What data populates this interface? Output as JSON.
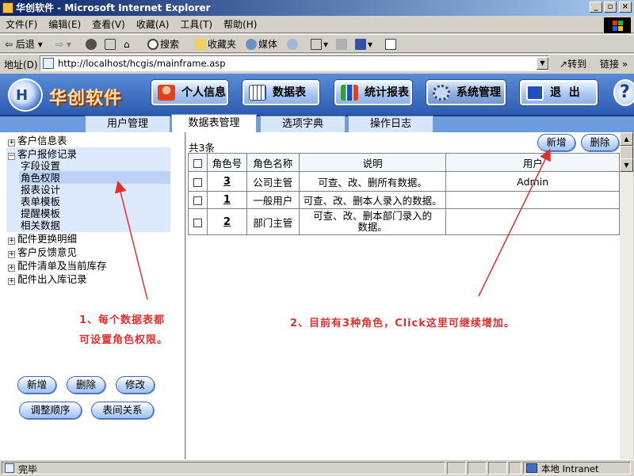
{
  "window": {
    "title": "华创软件 - Microsoft Internet Explorer"
  },
  "menu": [
    "文件(F)",
    "编辑(E)",
    "查看(V)",
    "收藏(A)",
    "工具(T)",
    "帮助(H)"
  ],
  "toolbar": {
    "back": "后退",
    "search": "搜索",
    "favorites": "收藏夹",
    "media": "媒体"
  },
  "address": {
    "label": "地址(D)",
    "url": "http://localhost/hcgis/mainframe.asp",
    "go": "转到",
    "links": "链接"
  },
  "app": {
    "logo_text": "华创软件",
    "logo_mark": "H",
    "nav": [
      "个人信息",
      "数据表",
      "统计报表",
      "系统管理",
      "退  出"
    ],
    "help": "?"
  },
  "tabs": [
    "用户管理",
    "数据表管理",
    "选项字典",
    "操作日志"
  ],
  "tree": {
    "items": [
      "客户信息表",
      "客户报修记录",
      "配件更换明细",
      "客户反馈意见",
      "配件清单及当前库存",
      "配件出入库记录"
    ],
    "expanded_children": [
      "字段设置",
      "角色权限",
      "报表设计",
      "表单模板",
      "提醒模板",
      "相关数据"
    ],
    "plus": "+",
    "minus": "−"
  },
  "left_buttons": {
    "add": "新增",
    "delete": "删除",
    "edit": "修改",
    "reorder": "调整顺序",
    "relation": "表间关系"
  },
  "annotations": {
    "left_line1": "1、每个数据表都",
    "left_line2": "可设置角色权限。",
    "right": "2、目前有3种角色，Click这里可继续增加。"
  },
  "roles": {
    "count": "共3条",
    "add": "新增",
    "delete": "删除",
    "headers": [
      "角色号",
      "角色名称",
      "说明",
      "用户"
    ],
    "rows": [
      {
        "id": "3",
        "name": "公司主管",
        "desc": "可查、改、删所有数据。",
        "user": "Admin"
      },
      {
        "id": "1",
        "name": "一般用户",
        "desc": "可查、改、删本人录入的数据。",
        "user": ""
      },
      {
        "id": "2",
        "name": "部门主管",
        "desc": "可查、改、删本部门录入的数据。",
        "user": ""
      }
    ]
  },
  "status": {
    "left": "完毕",
    "zone": "本地 Intranet"
  },
  "colors": {
    "annotation": "#e03030",
    "header_blue": "#2c5cb0",
    "tree_highlight": "#dce8fb"
  }
}
